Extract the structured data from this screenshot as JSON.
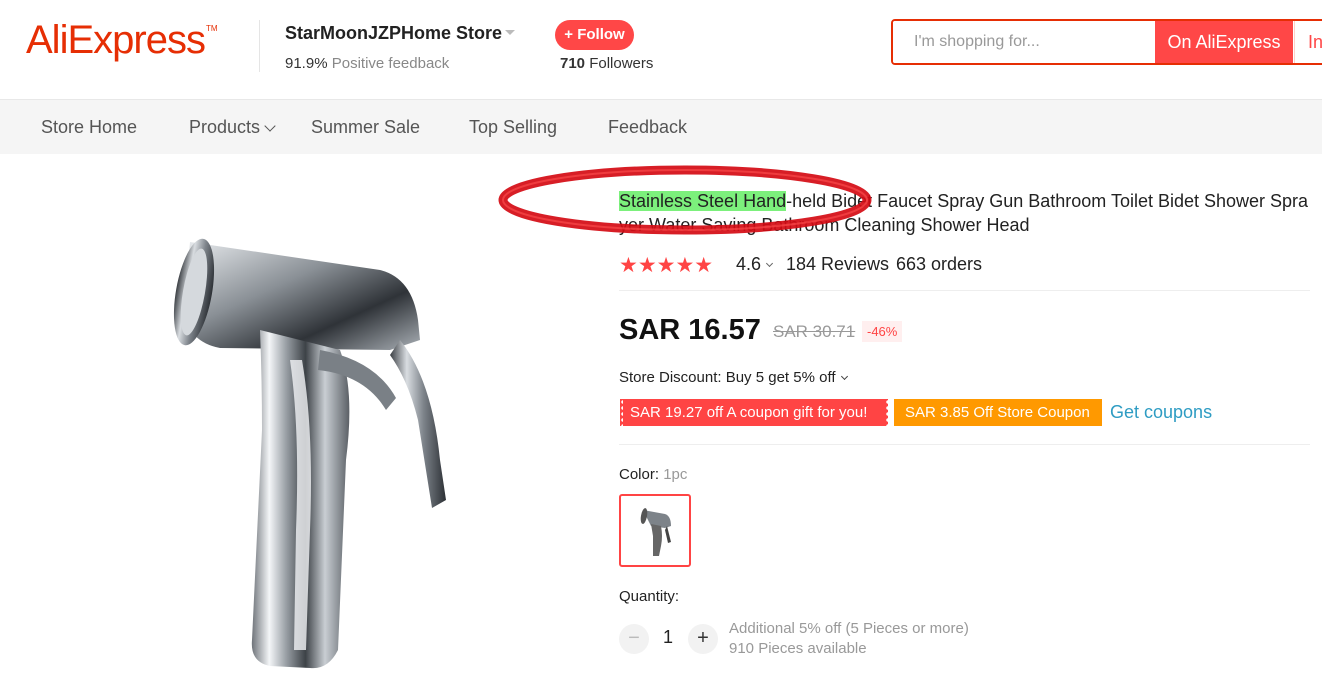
{
  "header": {
    "logo": "AliExpress",
    "store_name": "StarMoonJZPHome Store",
    "positive_feedback_value": "91.9%",
    "positive_feedback_label": "Positive feedback",
    "follow_label": "+ Follow",
    "followers_count": "710",
    "followers_label": "Followers",
    "search_placeholder": "I'm shopping for...",
    "search_on_aliexpress": "On AliExpress",
    "search_in_store": "In this store"
  },
  "nav": {
    "items": [
      "Store Home",
      "Products",
      "Summer Sale",
      "Top Selling",
      "Feedback"
    ]
  },
  "product": {
    "title_highlight": "Stainless Steel Hand",
    "title_rest": "-held Bidet Faucet Spray Gun Bathroom Toilet Bidet Shower Sprayer Water Saving Bathroom Cleaning Shower Head",
    "stars": "★★★★★",
    "rating": "4.6",
    "reviews": "184 Reviews",
    "orders": "663 orders",
    "price": "SAR 16.57",
    "old_price": "SAR 30.71",
    "discount": "-46%",
    "store_discount": "Store Discount: Buy 5 get 5% off",
    "coupon_red": "SAR 19.27 off A coupon gift for you!",
    "coupon_orange": "SAR 3.85 Off Store Coupon",
    "get_coupons": "Get coupons",
    "color_label": "Color:",
    "color_value": "1pc",
    "quantity_label": "Quantity:",
    "quantity_value": "1",
    "qty_minus": "−",
    "qty_plus": "+",
    "qty_note_1": "Additional 5% off (5 Pieces or more)",
    "qty_note_2": "910 Pieces available"
  },
  "colors": {
    "brand": "#e62e04",
    "accent": "#ff4747",
    "coupon_orange": "#ff9900",
    "link": "#2e9cc3",
    "highlight": "#7cf07c"
  }
}
